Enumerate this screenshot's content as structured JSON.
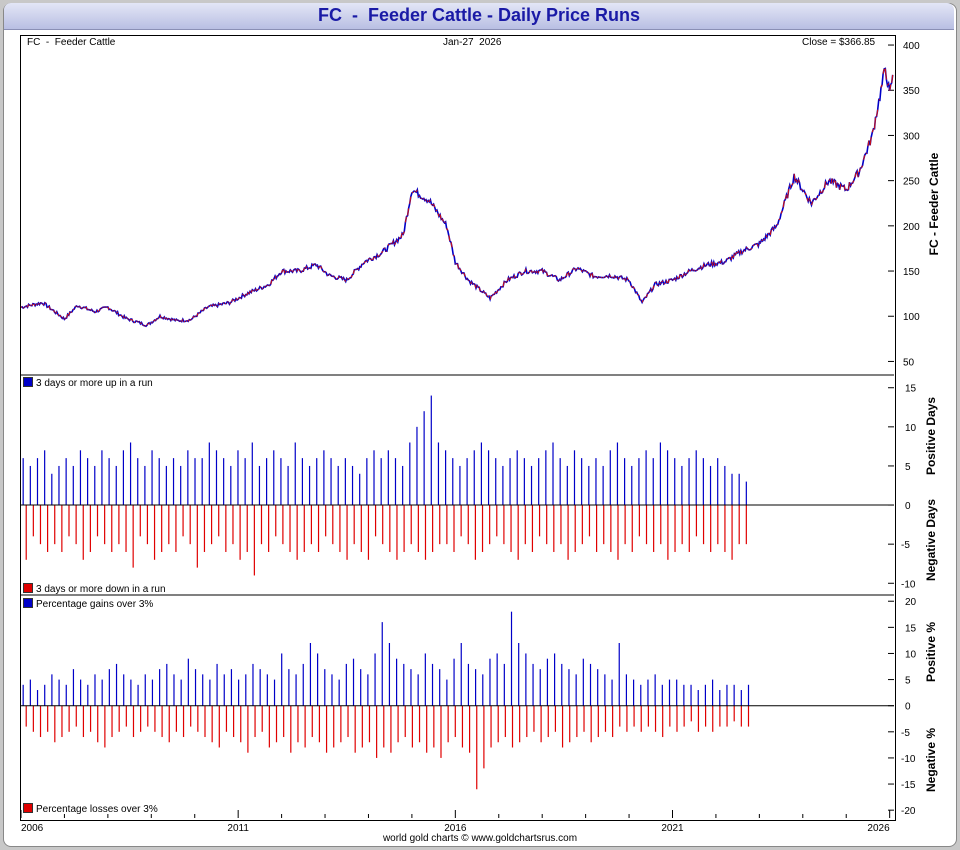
{
  "title": "FC  -  Feeder Cattle - Daily Price Runs",
  "header": {
    "left": "FC  -  Feeder Cattle",
    "center": "Jan-27  2026",
    "right": "Close = $366.85"
  },
  "footer": "world gold charts © www.goldchartsrus.com",
  "colors": {
    "up": "#0000c8",
    "down": "#e00000",
    "price": "#d01010",
    "title": "#1a1aa6"
  },
  "chart_data": [
    {
      "type": "line",
      "panel": "price",
      "ylabel": "FC  -  Feeder Cattle",
      "ylim": [
        35,
        410
      ],
      "yticks": [
        50,
        100,
        150,
        200,
        250,
        300,
        350,
        400
      ],
      "x": [
        2006.0,
        2006.5,
        2007.0,
        2007.3,
        2007.7,
        2008.0,
        2008.4,
        2008.9,
        2009.2,
        2009.6,
        2009.9,
        2010.3,
        2010.8,
        2011.2,
        2011.7,
        2012.0,
        2012.4,
        2012.8,
        2013.1,
        2013.5,
        2013.9,
        2014.3,
        2014.8,
        2015.0,
        2015.4,
        2015.8,
        2016.0,
        2016.3,
        2016.8,
        2017.2,
        2017.6,
        2018.0,
        2018.4,
        2018.8,
        2019.2,
        2019.6,
        2020.0,
        2020.3,
        2020.6,
        2021.0,
        2021.4,
        2021.8,
        2022.2,
        2022.6,
        2023.0,
        2023.4,
        2023.8,
        2024.2,
        2024.6,
        2025.0,
        2025.3,
        2025.6,
        2025.8,
        2025.9,
        2026.0,
        2026.07
      ],
      "y": [
        110,
        115,
        97,
        112,
        105,
        110,
        98,
        90,
        100,
        95,
        96,
        110,
        115,
        125,
        135,
        150,
        150,
        157,
        145,
        140,
        160,
        170,
        190,
        240,
        228,
        200,
        160,
        140,
        120,
        140,
        150,
        150,
        140,
        153,
        144,
        145,
        140,
        115,
        135,
        140,
        150,
        157,
        160,
        172,
        180,
        200,
        255,
        225,
        250,
        240,
        260,
        300,
        350,
        375,
        345,
        367
      ],
      "xticks": [
        2006,
        2011,
        2016,
        2021,
        2026
      ]
    },
    {
      "type": "bar",
      "panel": "runs",
      "series": [
        {
          "name": "3 days or more up in a run",
          "values": [
            6,
            5,
            6,
            7,
            4,
            5,
            6,
            5,
            7,
            6,
            5,
            7,
            6,
            5,
            7,
            8,
            6,
            5,
            7,
            6,
            5,
            6,
            5,
            7,
            6,
            6,
            8,
            7,
            6,
            5,
            7,
            6,
            8,
            5,
            6,
            7,
            6,
            5,
            8,
            6,
            5,
            6,
            7,
            6,
            5,
            6,
            5,
            4,
            6,
            7,
            6,
            7,
            6,
            5,
            8,
            10,
            12,
            14,
            8,
            7,
            6,
            5,
            6,
            7,
            8,
            7,
            6,
            5,
            6,
            7,
            6,
            5,
            6,
            7,
            8,
            6,
            5,
            7,
            6,
            5,
            6,
            5,
            7,
            8,
            6,
            5,
            6,
            7,
            6,
            8,
            7,
            6,
            5,
            6,
            7,
            6,
            5,
            6,
            5,
            4,
            4,
            3
          ]
        },
        {
          "name": "3 days or more down in a run",
          "values": [
            -7,
            -4,
            -5,
            -6,
            -5,
            -6,
            -4,
            -5,
            -7,
            -6,
            -4,
            -5,
            -6,
            -5,
            -6,
            -8,
            -4,
            -5,
            -7,
            -6,
            -5,
            -6,
            -4,
            -5,
            -8,
            -6,
            -5,
            -4,
            -6,
            -5,
            -7,
            -6,
            -9,
            -5,
            -6,
            -4,
            -5,
            -6,
            -7,
            -6,
            -5,
            -6,
            -4,
            -5,
            -6,
            -7,
            -5,
            -6,
            -7,
            -4,
            -5,
            -6,
            -7,
            -6,
            -5,
            -6,
            -7,
            -6,
            -5,
            -5,
            -6,
            -4,
            -5,
            -7,
            -6,
            -5,
            -4,
            -5,
            -6,
            -7,
            -5,
            -6,
            -4,
            -5,
            -6,
            -5,
            -7,
            -6,
            -5,
            -4,
            -6,
            -5,
            -6,
            -7,
            -5,
            -6,
            -4,
            -5,
            -6,
            -5,
            -7,
            -6,
            -5,
            -6,
            -4,
            -5,
            -6,
            -5,
            -6,
            -7,
            -5,
            -5
          ]
        }
      ],
      "ylabels": [
        "Positive Days",
        "Negative Days"
      ],
      "ylim": [
        -11.5,
        16.5
      ],
      "yticks": [
        15,
        10,
        5,
        0,
        -5,
        -10
      ]
    },
    {
      "type": "bar",
      "panel": "percent",
      "series": [
        {
          "name": "Percentage gains over 3%",
          "values": [
            4,
            5,
            3,
            4,
            6,
            5,
            4,
            7,
            5,
            4,
            6,
            5,
            7,
            8,
            6,
            5,
            4,
            6,
            5,
            7,
            8,
            6,
            5,
            9,
            7,
            6,
            5,
            8,
            6,
            7,
            5,
            6,
            8,
            7,
            6,
            5,
            10,
            7,
            6,
            8,
            12,
            10,
            7,
            6,
            5,
            8,
            9,
            7,
            6,
            10,
            16,
            12,
            9,
            8,
            7,
            6,
            10,
            8,
            7,
            5,
            9,
            12,
            8,
            7,
            6,
            9,
            10,
            8,
            18,
            12,
            10,
            8,
            7,
            9,
            10,
            8,
            7,
            6,
            9,
            8,
            7,
            6,
            5,
            12,
            6,
            5,
            4,
            5,
            6,
            4,
            5,
            5,
            4,
            4,
            3,
            4,
            5,
            3,
            4,
            4,
            3,
            4
          ]
        },
        {
          "name": "Percentage losses over 3%",
          "values": [
            -4,
            -5,
            -6,
            -5,
            -7,
            -6,
            -5,
            -4,
            -6,
            -5,
            -7,
            -8,
            -6,
            -5,
            -4,
            -6,
            -5,
            -4,
            -5,
            -6,
            -7,
            -5,
            -6,
            -4,
            -5,
            -6,
            -7,
            -8,
            -5,
            -6,
            -7,
            -9,
            -6,
            -5,
            -8,
            -7,
            -6,
            -9,
            -7,
            -8,
            -6,
            -7,
            -9,
            -8,
            -7,
            -6,
            -9,
            -8,
            -7,
            -10,
            -8,
            -9,
            -7,
            -6,
            -8,
            -7,
            -9,
            -8,
            -10,
            -7,
            -6,
            -8,
            -9,
            -16,
            -12,
            -8,
            -7,
            -6,
            -8,
            -7,
            -6,
            -5,
            -7,
            -6,
            -5,
            -8,
            -7,
            -6,
            -5,
            -7,
            -6,
            -5,
            -6,
            -4,
            -5,
            -4,
            -5,
            -4,
            -5,
            -6,
            -4,
            -5,
            -4,
            -3,
            -5,
            -4,
            -5,
            -4,
            -4,
            -3,
            -4,
            -4
          ]
        }
      ],
      "ylabels": [
        "Positive %",
        "Negative %"
      ],
      "ylim": [
        -21.5,
        21
      ],
      "yticks": [
        20,
        15,
        10,
        5,
        0,
        -5,
        -10,
        -15,
        -20
      ]
    }
  ]
}
